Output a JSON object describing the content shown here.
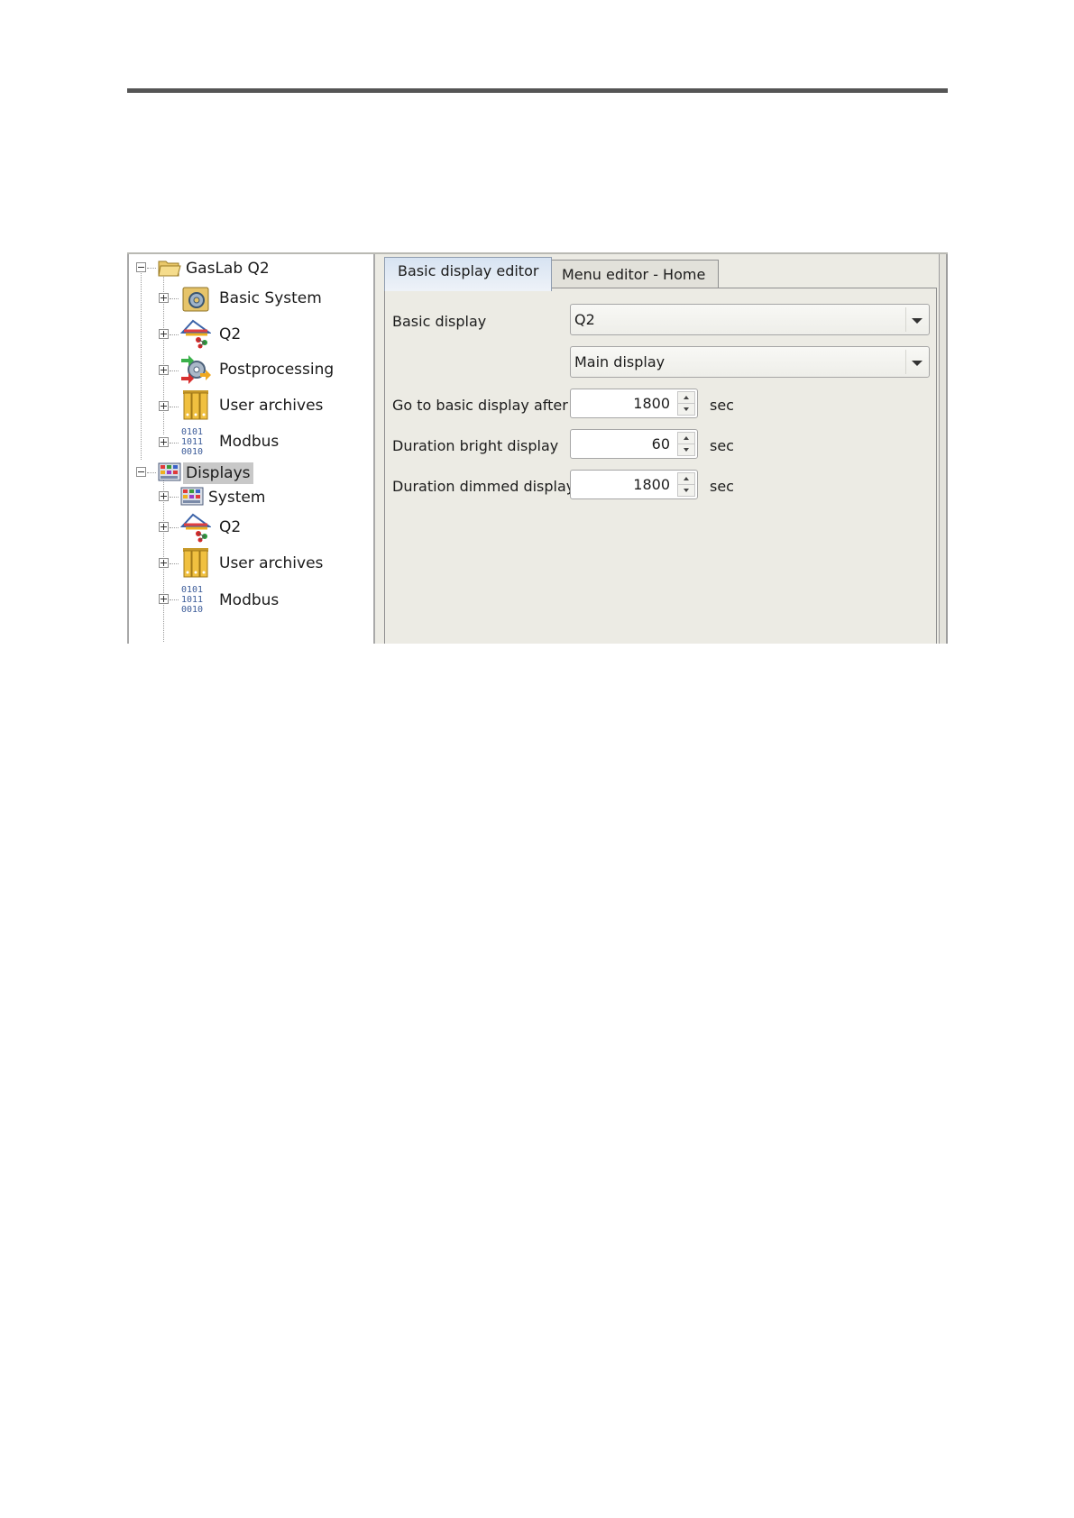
{
  "tree": {
    "root_label": "GasLab Q2",
    "root_children": [
      {
        "label": "Basic System",
        "icon": "gear-box-icon"
      },
      {
        "label": "Q2",
        "icon": "spectrum-icon"
      },
      {
        "label": "Postprocessing",
        "icon": "gears-arrows-icon"
      },
      {
        "label": "User archives",
        "icon": "archive-binders-icon"
      },
      {
        "label": "Modbus",
        "icon": "binary-data-icon"
      }
    ],
    "displays_label": "Displays",
    "displays_children": [
      {
        "label": "System",
        "icon": "display-grid-icon"
      },
      {
        "label": "Q2",
        "icon": "spectrum-icon"
      },
      {
        "label": "User archives",
        "icon": "archive-binders-icon"
      },
      {
        "label": "Modbus",
        "icon": "binary-data-icon"
      }
    ]
  },
  "tabs": {
    "active": "Basic display editor",
    "inactive": "Menu editor - Home"
  },
  "form": {
    "basic_display_label": "Basic display",
    "basic_display_value": "Q2",
    "display_select_value": "Main display",
    "goto_label": "Go to basic display after",
    "goto_value": "1800",
    "bright_label": "Duration bright display",
    "bright_value": "60",
    "dimmed_label": "Duration dimmed display",
    "dimmed_value": "1800",
    "unit": "sec"
  }
}
